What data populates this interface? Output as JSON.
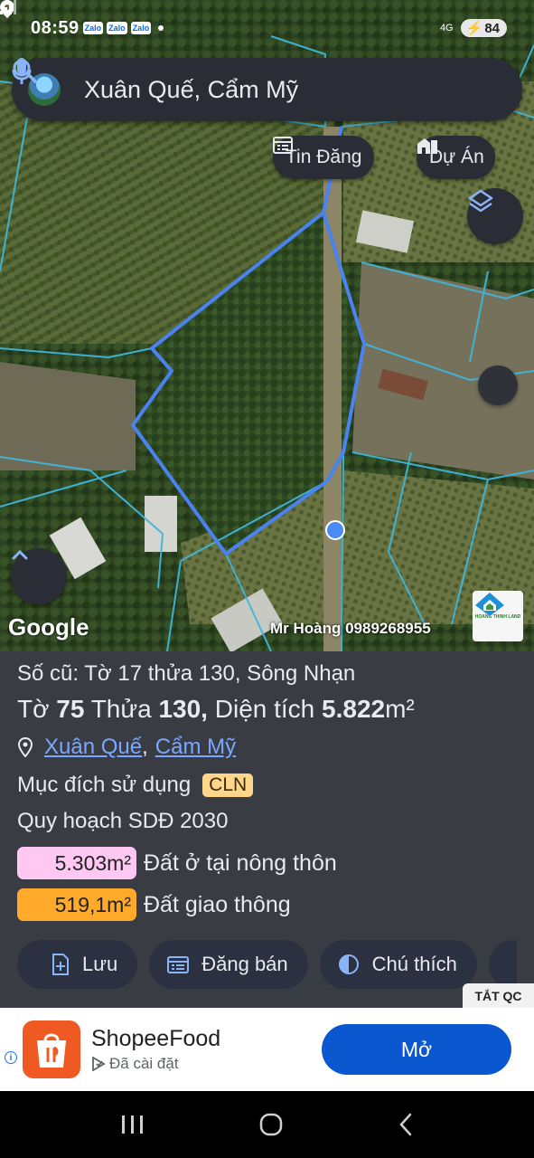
{
  "status": {
    "time": "08:59",
    "notifications": [
      "Zalo",
      "Zalo",
      "Zalo"
    ],
    "network": "4G",
    "battery": "84"
  },
  "search": {
    "value": "Xuân Quế, Cẩm Mỹ"
  },
  "map_chips": {
    "tin_dang": "Tin Đăng",
    "du_an": "Dự Án"
  },
  "map": {
    "attribution": "Google",
    "watermark": "Mr Hoàng 0989268955",
    "logo_text": "HOANG THINH LAND",
    "parcel_outline_color": "#4a82f0",
    "boundary_color": "#3fb6dc"
  },
  "parcel": {
    "old_number": "Số cũ: Tờ 17 thửa 130, Sông Nhạn",
    "to_label": "Tờ",
    "to_value": "75",
    "thua_label": "Thửa",
    "thua_value": "130,",
    "area_label": "Diện tích",
    "area_value": "5.822",
    "area_unit": "m²",
    "location_1": "Xuân Quế",
    "location_sep": ",",
    "location_2": "Cẩm Mỹ",
    "purpose_label": "Mục đích sử dụng",
    "purpose_code": "CLN",
    "plan_label": "Quy hoạch SDĐ 2030",
    "zones": [
      {
        "area": "5.303m²",
        "label": "Đất ở tại nông thôn",
        "color": "#ffc8f2"
      },
      {
        "area": "519,1m²",
        "label": "Đất giao thông",
        "color": "#ffaa2b"
      }
    ]
  },
  "actions": {
    "save": "Lưu",
    "post": "Đăng bán",
    "legend": "Chú thích"
  },
  "ad": {
    "close_label": "TẮT QC",
    "app_name": "ShopeeFood",
    "status": "Đã cài đặt",
    "open_label": "Mở"
  }
}
